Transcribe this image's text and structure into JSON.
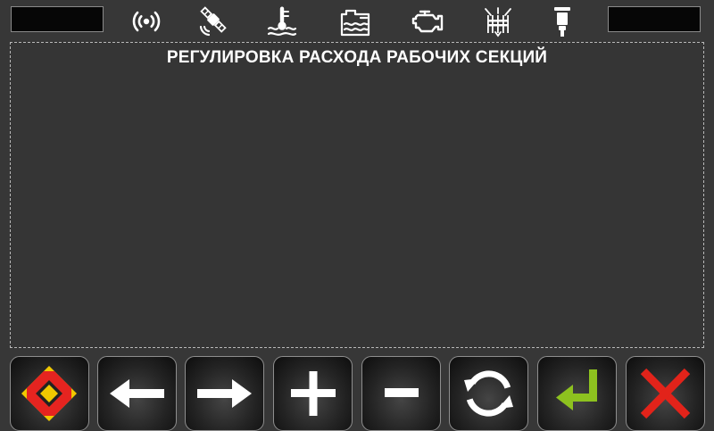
{
  "status_bar": {
    "left_value": "",
    "right_value": "",
    "icons": [
      "radio-signal-icon",
      "gps-satellite-icon",
      "coolant-temperature-icon",
      "fluid-tank-level-icon",
      "engine-check-icon",
      "sprayer-nozzles-icon",
      "tower-light-icon"
    ]
  },
  "main": {
    "title": "РЕГУЛИРОВКА РАСХОДА РАБОЧИХ СЕКЦИЙ"
  },
  "softkeys": [
    {
      "name": "navigation-home-button",
      "icon": "diamond-nav-icon",
      "color": "#f0c800"
    },
    {
      "name": "arrow-left-button",
      "icon": "arrow-left-icon",
      "color": "#ffffff"
    },
    {
      "name": "arrow-right-button",
      "icon": "arrow-right-icon",
      "color": "#ffffff"
    },
    {
      "name": "increase-button",
      "icon": "plus-icon",
      "color": "#ffffff"
    },
    {
      "name": "decrease-button",
      "icon": "minus-icon",
      "color": "#ffffff"
    },
    {
      "name": "refresh-button",
      "icon": "refresh-icon",
      "color": "#ffffff"
    },
    {
      "name": "enter-button",
      "icon": "enter-icon",
      "color": "#8dc21f"
    },
    {
      "name": "close-button",
      "icon": "close-x-icon",
      "color": "#e2231a"
    }
  ]
}
